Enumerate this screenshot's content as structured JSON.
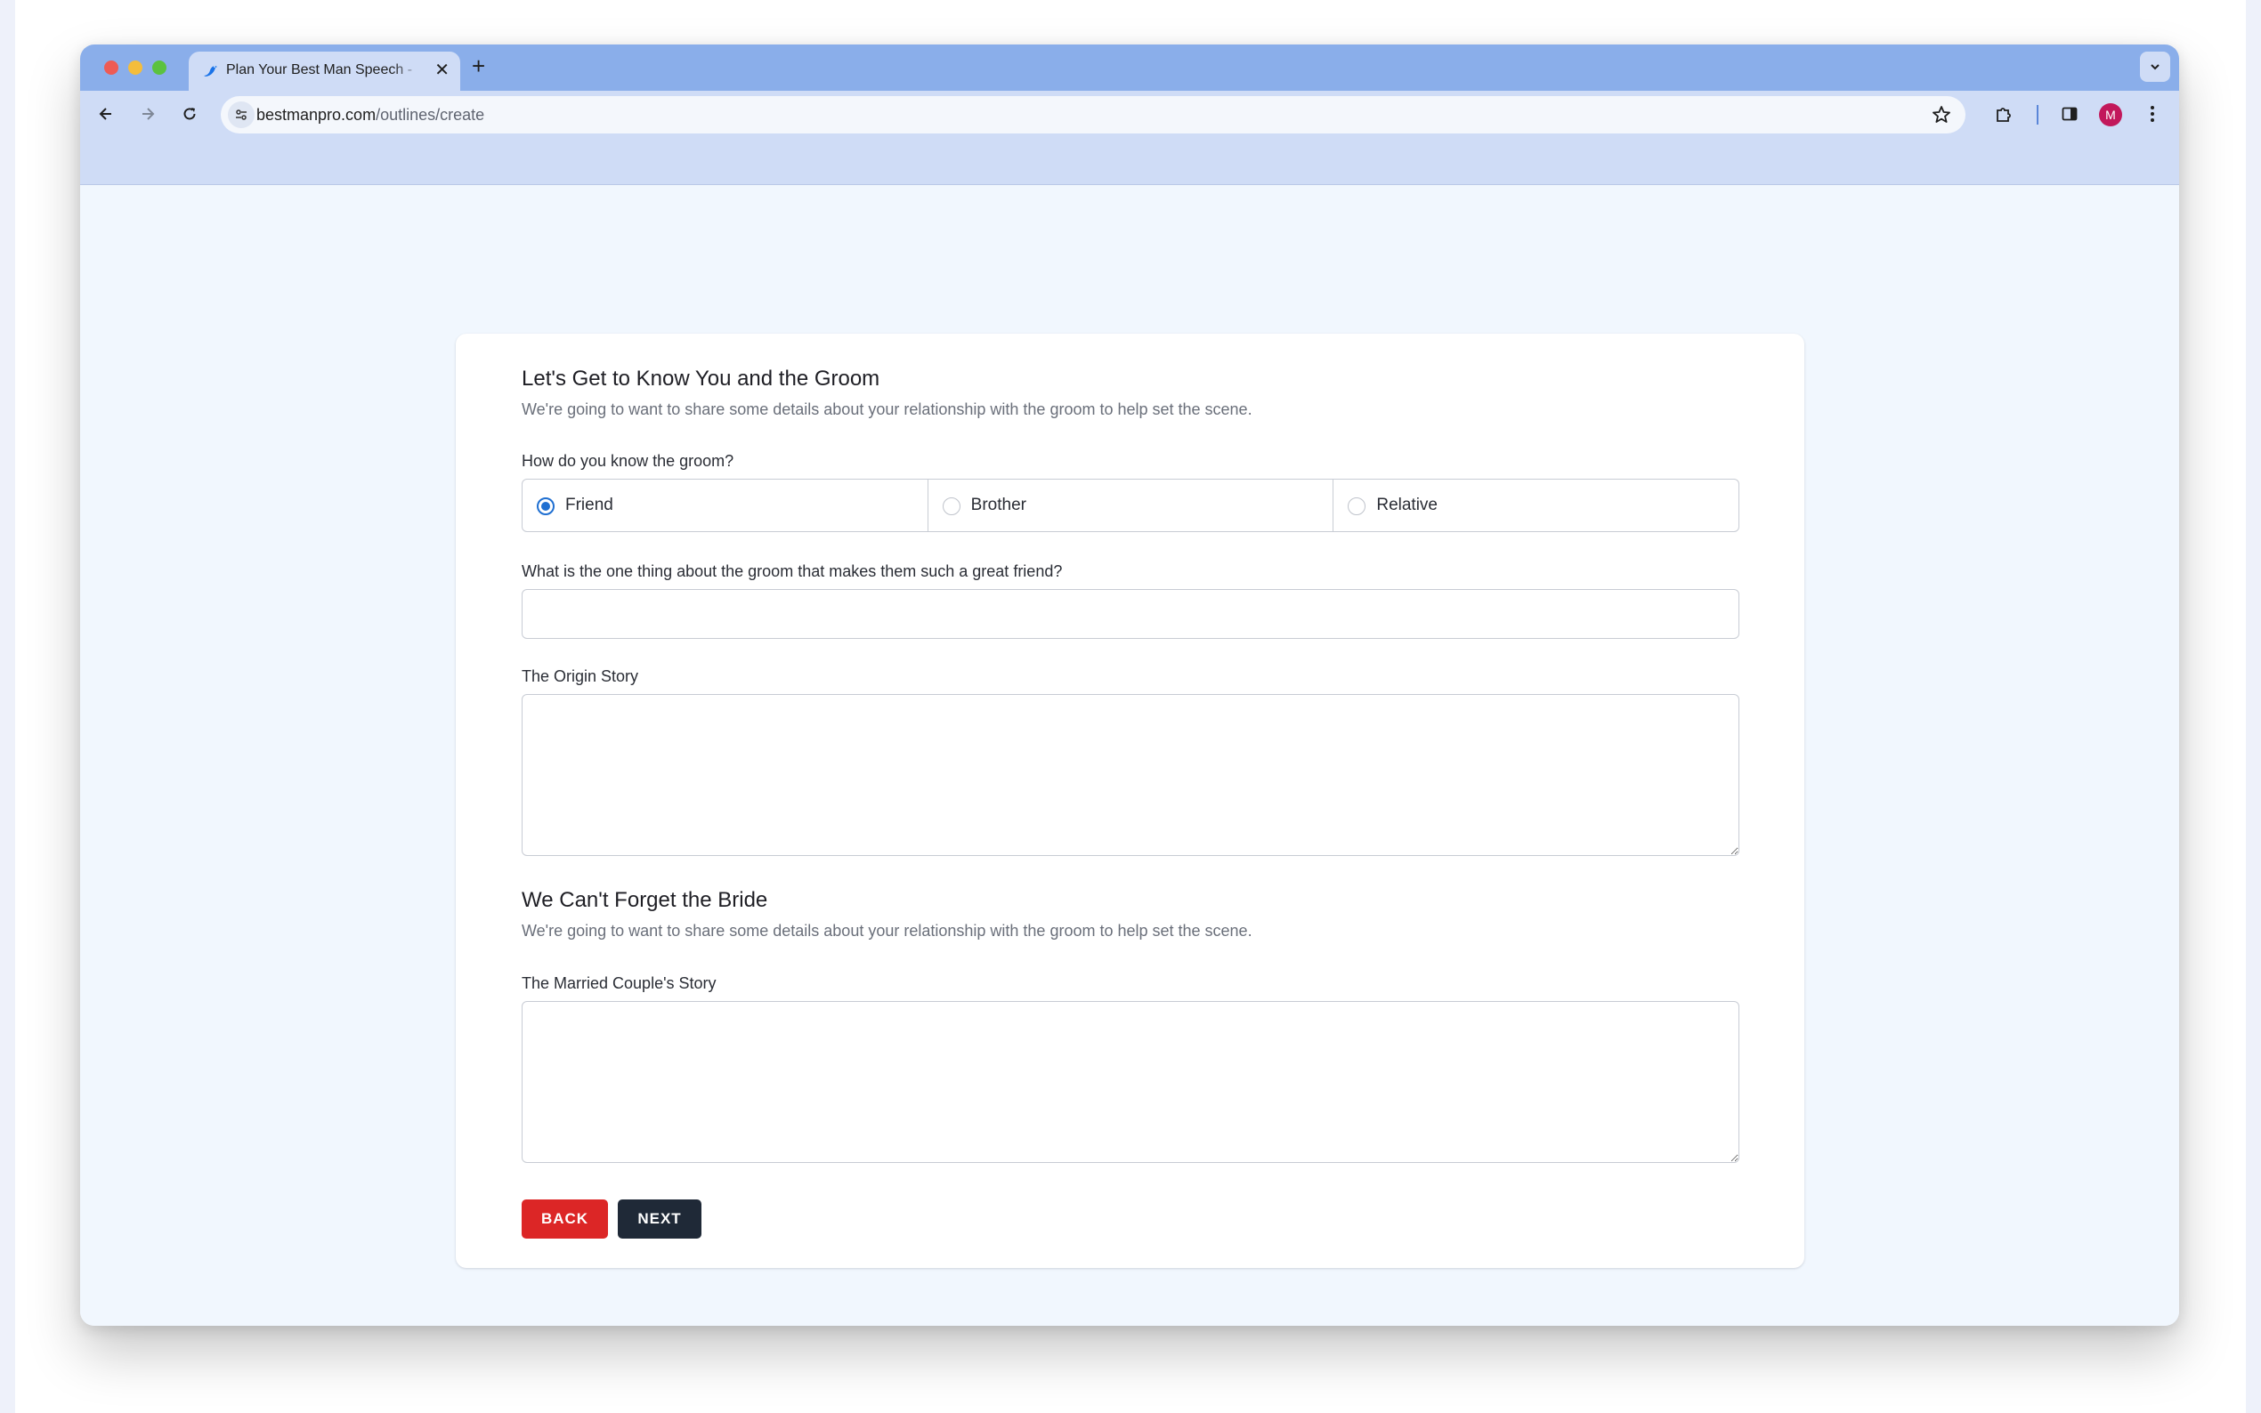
{
  "browser": {
    "tab_title": "Plan Your Best Man Speech -",
    "tab_close": "✕",
    "new_tab": "+",
    "tab_search_icon": "⌄",
    "url_domain": "bestmanpro.com",
    "url_path": "/outlines/create",
    "avatar_initial": "M"
  },
  "form": {
    "section1_title": "Let's Get to Know You and the Groom",
    "section1_subtitle": "We're going to want to share some details about your relationship with the groom to help set the scene.",
    "relationship_label": "How do you know the groom?",
    "relationship_options": [
      "Friend",
      "Brother",
      "Relative"
    ],
    "relationship_selected": "Friend",
    "great_friend_label": "What is the one thing about the groom that makes them such a great friend?",
    "great_friend_value": "",
    "origin_story_label": "The Origin Story",
    "origin_story_value": "",
    "section2_title": "We Can't Forget the Bride",
    "section2_subtitle": "We're going to want to share some details about your relationship with the groom to help set the scene.",
    "couple_story_label": "The Married Couple's Story",
    "couple_story_value": "",
    "back_label": "BACK",
    "next_label": "NEXT"
  },
  "icons": {
    "favicon": "bird-icon",
    "back": "arrow-left-icon",
    "forward": "arrow-right-icon",
    "reload": "reload-icon",
    "site_info": "tune-icon",
    "bookmark": "star-icon",
    "extensions": "puzzle-icon",
    "side_panel": "side-panel-icon",
    "menu": "kebab-menu-icon"
  },
  "colors": {
    "tabbar": "#8aaeea",
    "toolbar": "#cfdcf6",
    "page_bg": "#f1f7fe",
    "radio_accent": "#1f6fd1",
    "back_button": "#dc2626",
    "next_button": "#1f2937",
    "avatar": "#c2185b"
  }
}
